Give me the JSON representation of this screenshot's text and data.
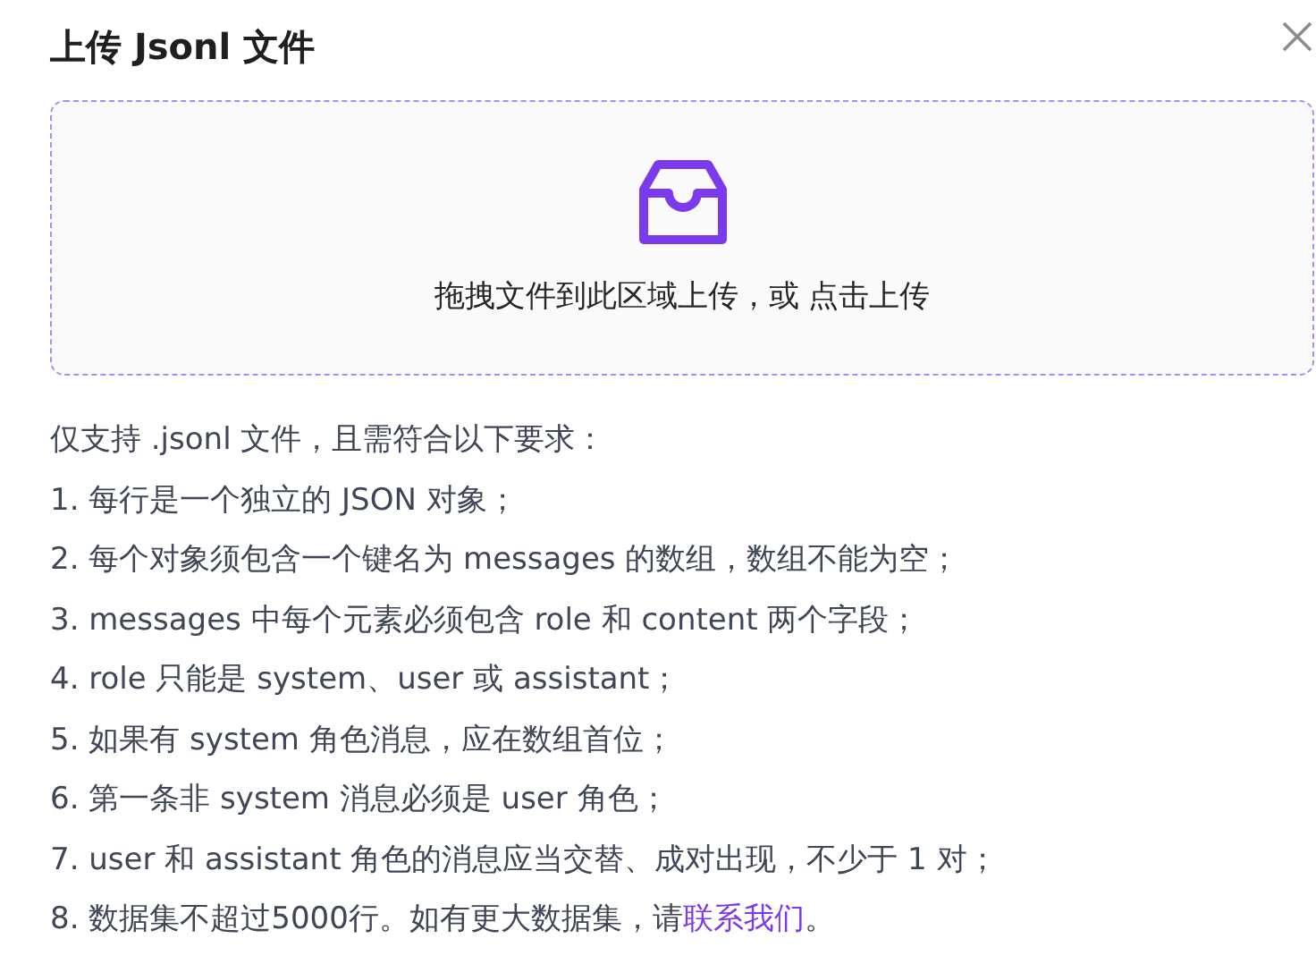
{
  "dialog": {
    "title": "上传 Jsonl 文件"
  },
  "dropzone": {
    "hint": "拖拽文件到此区域上传，或 点击上传"
  },
  "requirements": [
    {
      "text": "仅支持 .jsonl 文件，且需符合以下要求："
    },
    {
      "text": "1. 每行是一个独立的 JSON 对象；"
    },
    {
      "text": "2. 每个对象须包含一个键名为 messages 的数组，数组不能为空；"
    },
    {
      "text": "3. messages 中每个元素必须包含 role 和 content 两个字段；"
    },
    {
      "text": "4. role 只能是 system、user 或 assistant；"
    },
    {
      "text": "5. 如果有 system 角色消息，应在数组首位；"
    },
    {
      "text": "6. 第一条非 system 消息必须是 user 角色；"
    },
    {
      "text": "7. user 和 assistant 角色的消息应当交替、成对出现，不少于 1 对；"
    },
    {
      "text": "8. 数据集不超过5000行。如有更大数据集，请",
      "link": "联系我们",
      "after": "。"
    }
  ]
}
